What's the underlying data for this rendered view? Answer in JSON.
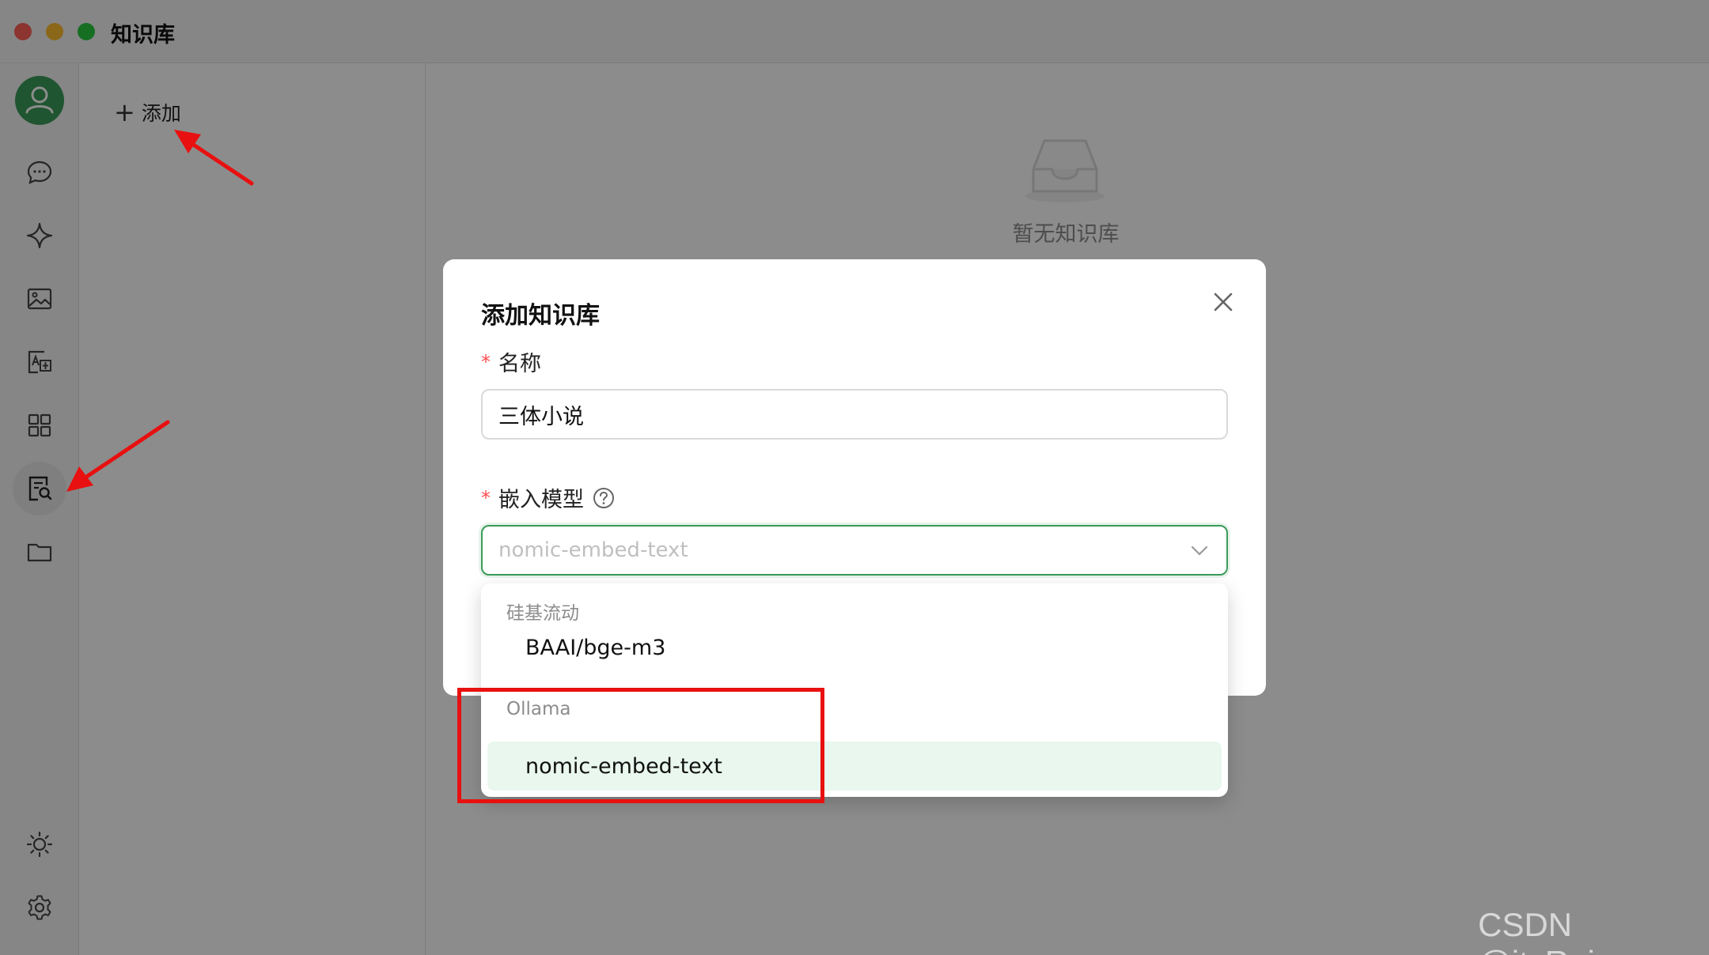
{
  "window": {
    "title": "知识库"
  },
  "sidebar": {
    "icons": [
      {
        "name": "chat-icon"
      },
      {
        "name": "sparkle-icon"
      },
      {
        "name": "image-icon"
      },
      {
        "name": "translate-icon"
      },
      {
        "name": "apps-icon"
      },
      {
        "name": "knowledge-icon",
        "active": true
      },
      {
        "name": "folder-icon"
      },
      {
        "name": "theme-sun-icon"
      },
      {
        "name": "settings-icon"
      }
    ]
  },
  "list_panel": {
    "add_label": "添加"
  },
  "main": {
    "empty_text": "暂无知识库"
  },
  "modal": {
    "title": "添加知识库",
    "name_field": {
      "label": "名称",
      "value": "三体小说"
    },
    "embed_field": {
      "label": "嵌入模型",
      "placeholder": "nomic-embed-text"
    }
  },
  "dropdown": {
    "groups": [
      {
        "label": "硅基流动",
        "options": [
          "BAAI/bge-m3"
        ]
      },
      {
        "label": "Ollama",
        "options": [
          "nomic-embed-text"
        ]
      }
    ],
    "selected": "nomic-embed-text"
  },
  "colors": {
    "accent": "#3a9b58",
    "selected_bg": "#e9f7ee",
    "required": "#ff4d4f",
    "annotation": "#e81010"
  },
  "watermark": "CSDN @itsRain"
}
